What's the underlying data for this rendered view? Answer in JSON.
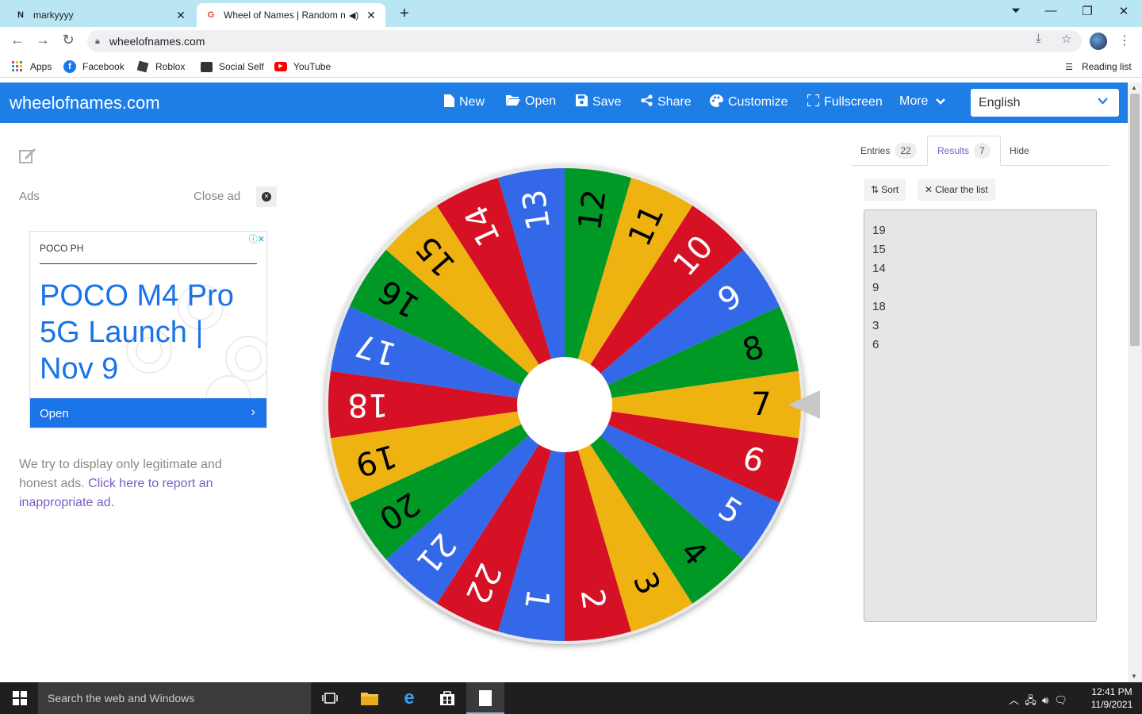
{
  "browser": {
    "tabs": [
      {
        "title": "markyyyy",
        "favicon": "N",
        "active": false
      },
      {
        "title": "Wheel of Names | Random n",
        "favicon": "G",
        "active": true
      }
    ],
    "new_tab": "+",
    "url": "wheelofnames.com",
    "bookmarks": [
      {
        "label": "Apps",
        "icon": "apps-grid-icon"
      },
      {
        "label": "Facebook",
        "icon": "facebook-icon"
      },
      {
        "label": "Roblox",
        "icon": "roblox-icon"
      },
      {
        "label": "Social Self",
        "icon": "social-self-icon"
      },
      {
        "label": "YouTube",
        "icon": "youtube-icon"
      }
    ],
    "reading_list": "Reading list"
  },
  "header": {
    "logo": "wheelofnames.com",
    "buttons": [
      {
        "label": "New",
        "icon": "file-icon"
      },
      {
        "label": "Open",
        "icon": "folder-open-icon"
      },
      {
        "label": "Save",
        "icon": "save-icon"
      },
      {
        "label": "Share",
        "icon": "share-icon"
      },
      {
        "label": "Customize",
        "icon": "palette-icon"
      },
      {
        "label": "Fullscreen",
        "icon": "fullscreen-icon"
      }
    ],
    "more": "More",
    "language": "English"
  },
  "ads": {
    "label": "Ads",
    "close_label": "Close ad",
    "brand": "POCO PH",
    "title": "POCO M4 Pro 5G Launch | Nov 9",
    "open_label": "Open",
    "note_text": "We try to display only legitimate and honest ads. ",
    "note_link": "Click here to report an inappropriate ad."
  },
  "wheel": {
    "labels": [
      "1",
      "2",
      "3",
      "4",
      "5",
      "6",
      "7",
      "8",
      "9",
      "10",
      "11",
      "12",
      "13",
      "14",
      "15",
      "16",
      "17",
      "18",
      "19",
      "20",
      "21",
      "22"
    ],
    "colors": {
      "red": "#d61126",
      "yellow": "#eeb211",
      "green": "#009925",
      "blue": "#3369e8"
    },
    "pointer_color": "#c8c8c8"
  },
  "panel": {
    "tabs": [
      {
        "label": "Entries",
        "count": "22"
      },
      {
        "label": "Results",
        "count": "7"
      },
      {
        "label": "Hide"
      }
    ],
    "sort_label": "Sort",
    "clear_label": "Clear the list",
    "results": [
      "19",
      "15",
      "14",
      "9",
      "18",
      "3",
      "6"
    ]
  },
  "taskbar": {
    "search_placeholder": "Search the web and Windows",
    "time": "12:41 PM",
    "date": "11/9/2021"
  }
}
